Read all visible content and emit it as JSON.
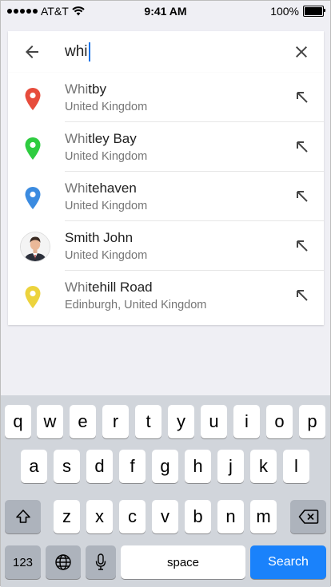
{
  "status": {
    "carrier": "AT&T",
    "time": "9:41 AM",
    "battery": "100%"
  },
  "search": {
    "query": "whi"
  },
  "results": [
    {
      "kind": "place",
      "pin_color": "#e74c3c",
      "match": "Whi",
      "rest": "tby",
      "subtitle": "United Kingdom"
    },
    {
      "kind": "place",
      "pin_color": "#2ecc40",
      "match": "Whi",
      "rest": "tley Bay",
      "subtitle": "United Kingdom"
    },
    {
      "kind": "place",
      "pin_color": "#3b8be0",
      "match": "Whi",
      "rest": "tehaven",
      "subtitle": "United Kingdom"
    },
    {
      "kind": "contact",
      "match": "",
      "rest": "Smith John",
      "subtitle": "United Kingdom"
    },
    {
      "kind": "place",
      "pin_color": "#ecd33d",
      "match": "Whi",
      "rest": "tehill Road",
      "subtitle": "Edinburgh, United Kingdom"
    }
  ],
  "keyboard": {
    "row1": [
      "q",
      "w",
      "e",
      "r",
      "t",
      "y",
      "u",
      "i",
      "o",
      "p"
    ],
    "row2": [
      "a",
      "s",
      "d",
      "f",
      "g",
      "h",
      "j",
      "k",
      "l"
    ],
    "row3": [
      "z",
      "x",
      "c",
      "v",
      "b",
      "n",
      "m"
    ],
    "numbers_label": "123",
    "space_label": "space",
    "search_label": "Search",
    "icons": {
      "shift": "shift-icon",
      "delete": "delete-icon",
      "globe": "globe-icon",
      "mic": "microphone-icon"
    }
  }
}
